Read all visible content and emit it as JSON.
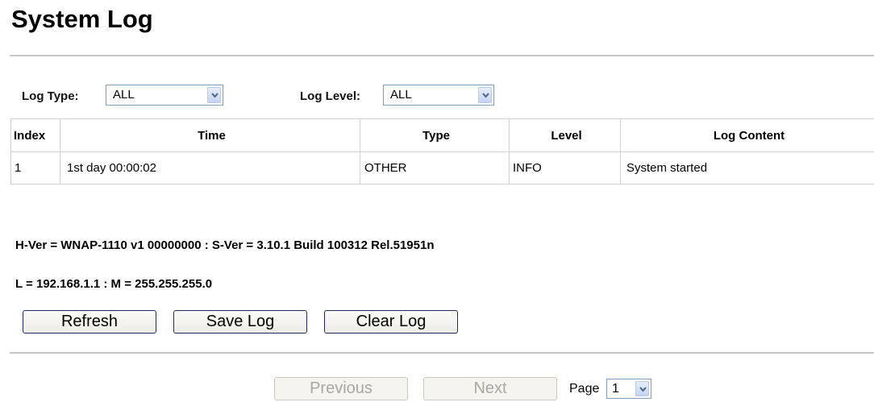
{
  "page": {
    "title": "System Log"
  },
  "filters": {
    "log_type_label": "Log Type:",
    "log_type_value": "ALL",
    "log_level_label": "Log Level:",
    "log_level_value": "ALL"
  },
  "table": {
    "headers": [
      "Index",
      "Time",
      "Type",
      "Level",
      "Log Content"
    ],
    "rows": [
      {
        "index": "1",
        "time": "1st day 00:00:02",
        "type": "OTHER",
        "level": "INFO",
        "content": "System started"
      }
    ]
  },
  "info": {
    "version_line": "H-Ver = WNAP-1110 v1 00000000 : S-Ver = 3.10.1 Build 100312 Rel.51951n",
    "address_line": "L = 192.168.1.1 : M = 255.255.255.0"
  },
  "buttons": {
    "refresh": "Refresh",
    "save_log": "Save Log",
    "clear_log": "Clear Log"
  },
  "pagination": {
    "previous": "Previous",
    "next": "Next",
    "page_label": "Page",
    "page_value": "1"
  },
  "colors": {
    "select_border": "#7f9db9",
    "button_border": "#1c2e5a",
    "divider": "#c8c8c8"
  }
}
